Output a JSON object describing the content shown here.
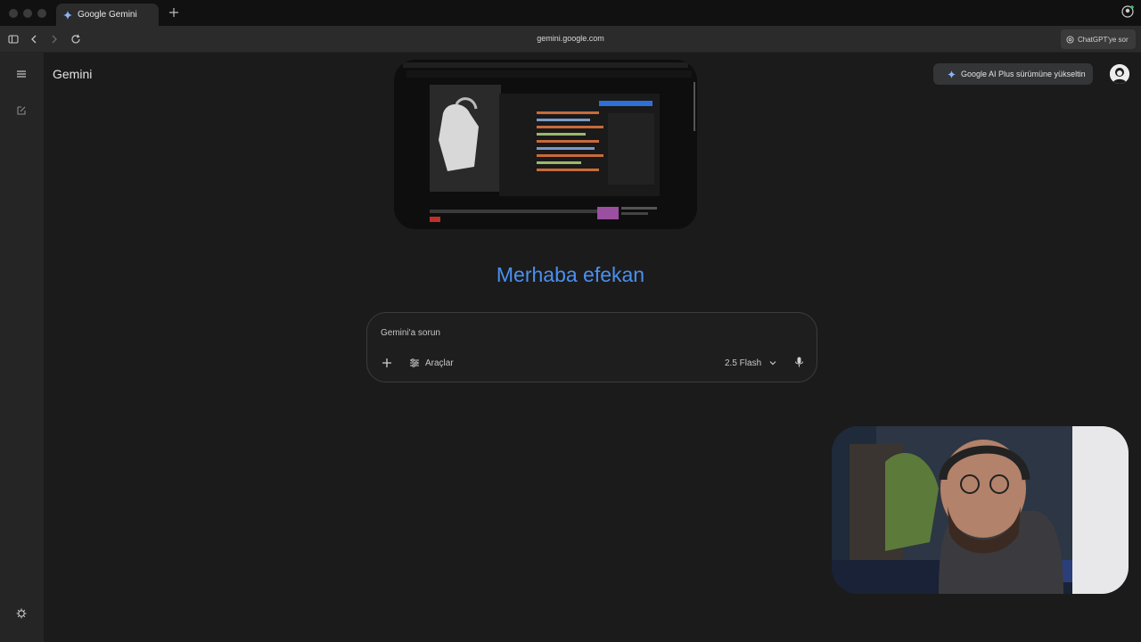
{
  "browser": {
    "tab_title": "Google Gemini",
    "url": "gemini.google.com",
    "ask_chatgpt_label": "ChatGPT'ye sor"
  },
  "app": {
    "brand": "Gemini",
    "upgrade_label": "Google AI Plus sürümüne yükseltin",
    "greeting": "Merhaba efekan",
    "prompt_placeholder": "Gemini'a sorun",
    "tools_label": "Araçlar",
    "model_label": "2.5 Flash"
  },
  "icons": [
    "sidebar-toggle-icon",
    "back-icon",
    "forward-icon",
    "reload-icon",
    "new-tab-icon",
    "menu-icon",
    "new-chat-icon",
    "settings-icon",
    "sparkle-icon",
    "plus-icon",
    "tools-icon",
    "chevron-down-icon",
    "mic-icon"
  ],
  "colors": {
    "greeting": "#4a90f0",
    "background": "#1b1b1b",
    "sidebar": "#252525"
  }
}
